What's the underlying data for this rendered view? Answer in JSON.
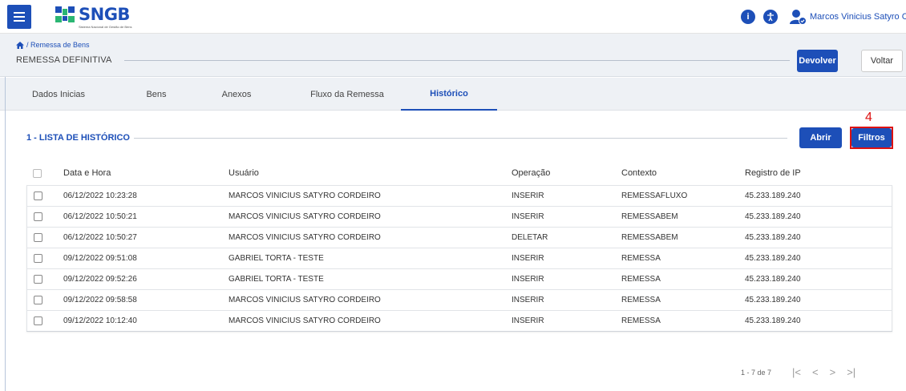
{
  "header": {
    "logo_text": "SNGB",
    "logo_subtitle": "Sistema Nacional de Gestão de Bens",
    "info_icon": "info-icon",
    "accessibility_icon": "accessibility-icon",
    "user_icon": "user-icon",
    "username": "Marcos Vinicius Satyro C..."
  },
  "breadcrumb": {
    "home_icon": "home-icon",
    "text": "/ Remessa de Bens"
  },
  "page": {
    "title": "REMESSA DEFINITIVA",
    "devolver_label": "Devolver",
    "voltar_label": "Voltar"
  },
  "tabs": [
    {
      "label": "Dados Inicias"
    },
    {
      "label": "Bens"
    },
    {
      "label": "Anexos"
    },
    {
      "label": "Fluxo da Remessa"
    },
    {
      "label": "Histórico",
      "active": true
    }
  ],
  "section": {
    "title": "1 - LISTA DE HISTÓRICO",
    "abrir_label": "Abrir",
    "filtros_label": "Filtros",
    "annotation": "4"
  },
  "table": {
    "headers": [
      "Data e Hora",
      "Usuário",
      "Operação",
      "Contexto",
      "Registro de IP"
    ],
    "rows": [
      [
        "06/12/2022 10:23:28",
        "MARCOS VINICIUS SATYRO CORDEIRO",
        "INSERIR",
        "REMESSAFLUXO",
        "45.233.189.240"
      ],
      [
        "06/12/2022 10:50:21",
        "MARCOS VINICIUS SATYRO CORDEIRO",
        "INSERIR",
        "REMESSABEM",
        "45.233.189.240"
      ],
      [
        "06/12/2022 10:50:27",
        "MARCOS VINICIUS SATYRO CORDEIRO",
        "DELETAR",
        "REMESSABEM",
        "45.233.189.240"
      ],
      [
        "09/12/2022 09:51:08",
        "GABRIEL TORTA - TESTE",
        "INSERIR",
        "REMESSA",
        "45.233.189.240"
      ],
      [
        "09/12/2022 09:52:26",
        "GABRIEL TORTA - TESTE",
        "INSERIR",
        "REMESSA",
        "45.233.189.240"
      ],
      [
        "09/12/2022 09:58:58",
        "MARCOS VINICIUS SATYRO CORDEIRO",
        "INSERIR",
        "REMESSA",
        "45.233.189.240"
      ],
      [
        "09/12/2022 10:12:40",
        "MARCOS VINICIUS SATYRO CORDEIRO",
        "INSERIR",
        "REMESSA",
        "45.233.189.240"
      ]
    ]
  },
  "pager": {
    "summary": "1 - 7 de 7",
    "first": "|<",
    "prev": "<",
    "next": ">",
    "last": ">|"
  },
  "colors": {
    "primary": "#1d4fb8",
    "annotation": "#dd1111",
    "subheader_bg": "#eef1f5"
  }
}
